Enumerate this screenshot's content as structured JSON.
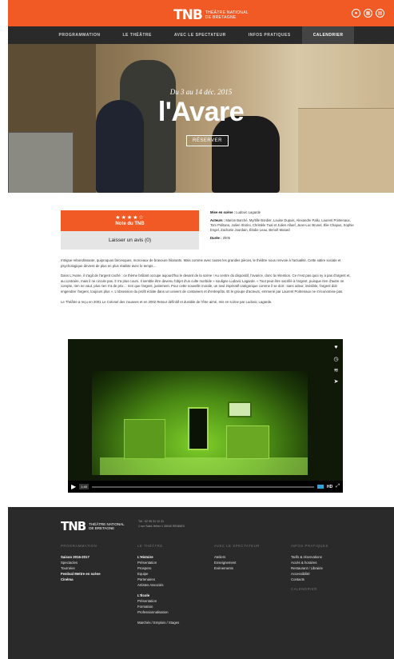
{
  "brand": {
    "mark": "TNB",
    "name_line1": "THÉÂTRE NATIONAL",
    "name_line2": "DE BRETAGNE"
  },
  "top_icons": [
    "user-icon",
    "calendar-icon",
    "ticket-icon"
  ],
  "nav": [
    {
      "label": "PROGRAMMATION"
    },
    {
      "label": "LE THÉÂTRE"
    },
    {
      "label": "AVEC LE SPECTATEUR"
    },
    {
      "label": "INFOS PRATIQUES"
    },
    {
      "label": "CALENDRIER"
    }
  ],
  "hero": {
    "date": "Du 3 au 14 déc. 2015",
    "title": "l'Avare",
    "button": "RÉSERVER"
  },
  "rating": {
    "stars": "★★★★☆",
    "label": "Note du TNB",
    "review_button": "Laisser un avis (0)"
  },
  "credits": {
    "mise_label": "Mise en scène :",
    "mise_value": " Ludovic Lagarde",
    "acteurs_label": "Acteurs :",
    "acteurs_value": " Marion Barché, Myrtille Bordier, Louise Dupuis, Alexandre Pallu, Laurent Poitrenaux, Tom Politano, Julien Storini, Christèle Tual et Julien Alluef, Jean-Luc Brunel, Élie Chapus, Sophie Engel, Zacharie Jourdain, Élodie Leau, Benoît Mutard",
    "duree_label": "Durée :",
    "duree_value": " 2h05"
  },
  "body": {
    "p1": "Intrigue rebondissante, quiproquos farcesques, morceaux de bravoure hilarants. Mais comme avec toutes les grandes pièces, le théâtre nous renvoie à l'actualité. Cette satire sociale et psychologique devient de plus en plus réaliste avec le temps…",
    "p2": "Dans L'Avare, il s'agit de l'argent caché : ce thème brûlant occupe aujourd'hui le devant de la scène ! Au centre du dispositif, l'avarice, donc la rétention. Ce n'est pas quoi ny a pas d'argent et, au contraire, mais il ne circule pas. Il n'a plus cours. Il semble être devenu l'objet d'un culte morbide » souligne Ludovic Lagarde. « Tout peut être sacrifié à l'argent, puisque rien d'autre ne compte, rien ne vaut, plus rien n'a de prix… rien que l'argent, justement. Pour cette nouvelle morale, un seul impératif catégorique comme il se doit : sans odeur, invisible, l'argent doit engendrer l'argent, toujours plus ». L'obsession du profit éclate dans un univers de containers et d'entrepôts. Et le groupe d'acteurs, emmené par Laurent Poitrenaux ne s'économise pas.",
    "p3": "Le Théâtre a reçu en 2001 Le Colonel des zouaves et en 2002 Retour définitif et durable de l'être aimé, mis en scène par Ludovic Lagarde."
  },
  "video": {
    "time": "1:40",
    "hd": "HD",
    "side_icons": [
      "heart-icon",
      "clock-icon",
      "layers-icon",
      "share-icon"
    ]
  },
  "footer": {
    "logo": {
      "mark": "TNB",
      "line1": "THÉÂTRE NATIONAL",
      "line2": "DE BRETAGNE"
    },
    "phone": "Tél : 02 99 31 12 31",
    "address": "1 rue Saint-Hélier // 35040 RENNES",
    "col1": {
      "heading": "PROGRAMMATION",
      "items": [
        "Saison 2016-2017",
        "Spectacles",
        "Tournées",
        "Festival Mettre en scène",
        "Cinéma"
      ]
    },
    "col2": {
      "heading": "LE THÉÂTRE",
      "items": [
        "L'Histoire",
        "Présentation",
        "Prospero",
        "Equipe",
        "Partenaires",
        "Artistes Associés"
      ],
      "ecole_heading": "L'École",
      "ecole_items": [
        "Présentation",
        "Formation",
        "Professionnalisation"
      ],
      "extra": "Marchés / Emplois / Stages"
    },
    "col3": {
      "heading": "AVEC LE SPECTATEUR",
      "items": [
        "Ateliers",
        "Enseignement",
        "Evènements"
      ]
    },
    "col4": {
      "heading": "INFOS PRATIQUES",
      "items": [
        "Tarifs & réservations",
        "Accès & horaires",
        "Restaurant / Librairie",
        "Accessibilité",
        "Contacts"
      ],
      "heading2": "CALENDRIER"
    }
  }
}
